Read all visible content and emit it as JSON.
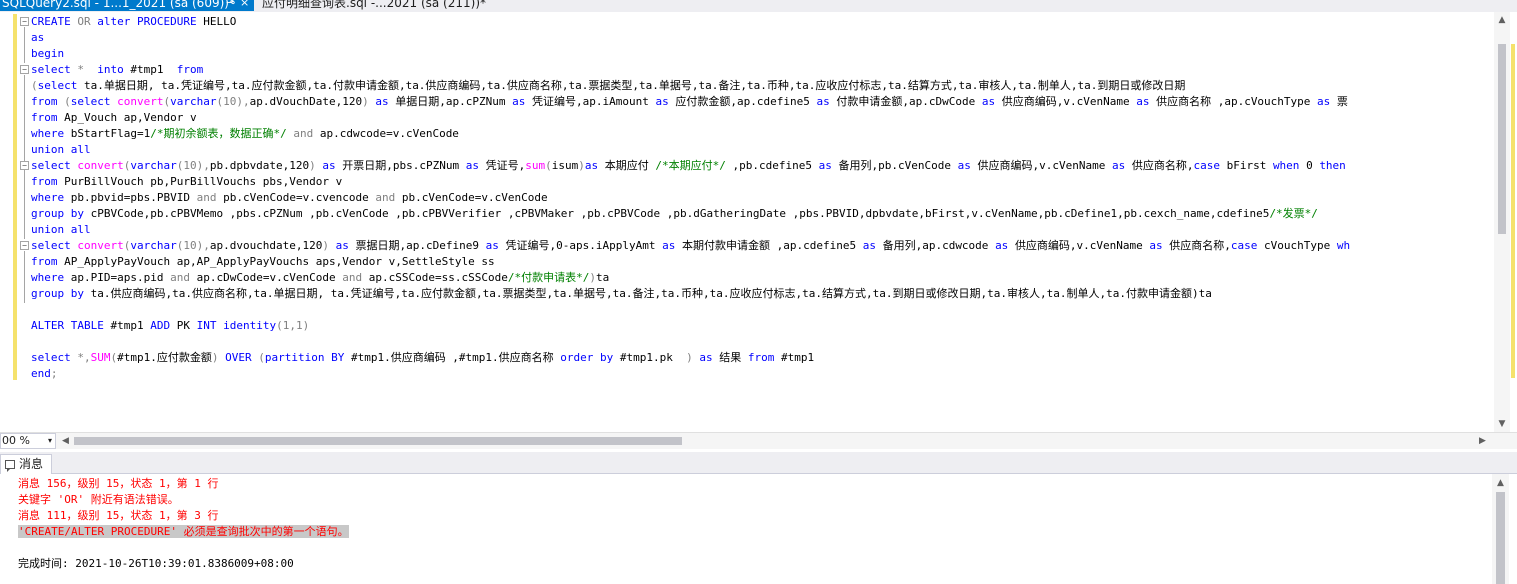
{
  "tabs": [
    {
      "title": "SQLQuery2.sql - 1...1_2021 (sa (609))*",
      "pin": "⊸",
      "close": "×",
      "active": true
    },
    {
      "title": "应付明细查询表.sql -...2021 (sa (211))*",
      "active": false
    }
  ],
  "code_lines": [
    [
      {
        "t": "CREATE ",
        "c": "kw"
      },
      {
        "t": "OR ",
        "c": "gr"
      },
      {
        "t": "alter PROCEDURE ",
        "c": "kw"
      },
      {
        "t": "HELLO",
        "c": ""
      }
    ],
    [
      {
        "t": "as",
        "c": "kw"
      }
    ],
    [
      {
        "t": "begin",
        "c": "kw"
      }
    ],
    [
      {
        "t": "select ",
        "c": "kw"
      },
      {
        "t": "* ",
        "c": "gr"
      },
      {
        "t": " into ",
        "c": "kw"
      },
      {
        "t": "#tmp1  ",
        "c": ""
      },
      {
        "t": "from",
        "c": "kw"
      }
    ],
    [
      {
        "t": "(",
        "c": "gr"
      },
      {
        "t": "select ",
        "c": "kw"
      },
      {
        "t": "ta.单据日期, ta.凭证编号,ta.应付款金额,ta.付款申请金额,ta.供应商编码,ta.供应商名称,ta.票据类型,ta.单据号,ta.备注,ta.币种,ta.应收应付标志,ta.结算方式,ta.审核人,ta.制单人,ta.到期日或修改日期",
        "c": ""
      }
    ],
    [
      {
        "t": "from ",
        "c": "kw"
      },
      {
        "t": "(",
        "c": "gr"
      },
      {
        "t": "select ",
        "c": "kw"
      },
      {
        "t": "convert",
        "c": "fn"
      },
      {
        "t": "(",
        "c": "gr"
      },
      {
        "t": "varchar",
        "c": "kw"
      },
      {
        "t": "(10),",
        "c": "gr"
      },
      {
        "t": "ap.dVouchDate,120",
        "c": ""
      },
      {
        "t": ") ",
        "c": "gr"
      },
      {
        "t": "as ",
        "c": "kw"
      },
      {
        "t": "单据日期,ap.cPZNum ",
        "c": ""
      },
      {
        "t": "as ",
        "c": "kw"
      },
      {
        "t": "凭证编号,ap.iAmount ",
        "c": ""
      },
      {
        "t": "as ",
        "c": "kw"
      },
      {
        "t": "应付款金额,ap.cdefine5 ",
        "c": ""
      },
      {
        "t": "as ",
        "c": "kw"
      },
      {
        "t": "付款申请金额,ap.cDwCode ",
        "c": ""
      },
      {
        "t": "as ",
        "c": "kw"
      },
      {
        "t": "供应商编码,v.cVenName ",
        "c": ""
      },
      {
        "t": "as ",
        "c": "kw"
      },
      {
        "t": "供应商名称 ,ap.cVouchType ",
        "c": ""
      },
      {
        "t": "as ",
        "c": "kw"
      },
      {
        "t": "票",
        "c": ""
      }
    ],
    [
      {
        "t": "from ",
        "c": "kw"
      },
      {
        "t": "Ap_Vouch ap,Vendor v",
        "c": ""
      }
    ],
    [
      {
        "t": "where ",
        "c": "kw"
      },
      {
        "t": "bStartFlag=1",
        "c": ""
      },
      {
        "t": "/*期初余额表，数据正确*/ ",
        "c": "cm"
      },
      {
        "t": "and ",
        "c": "gr"
      },
      {
        "t": "ap.cdwcode=v.cVenCode",
        "c": ""
      }
    ],
    [
      {
        "t": "union all",
        "c": "kw"
      }
    ],
    [
      {
        "t": "select ",
        "c": "kw"
      },
      {
        "t": "convert",
        "c": "fn"
      },
      {
        "t": "(",
        "c": "gr"
      },
      {
        "t": "varchar",
        "c": "kw"
      },
      {
        "t": "(10),",
        "c": "gr"
      },
      {
        "t": "pb.dpbvdate,120",
        "c": ""
      },
      {
        "t": ") ",
        "c": "gr"
      },
      {
        "t": "as ",
        "c": "kw"
      },
      {
        "t": "开票日期,pbs.cPZNum ",
        "c": ""
      },
      {
        "t": "as ",
        "c": "kw"
      },
      {
        "t": "凭证号,",
        "c": ""
      },
      {
        "t": "sum",
        "c": "fn"
      },
      {
        "t": "(",
        "c": "gr"
      },
      {
        "t": "isum",
        "c": ""
      },
      {
        "t": ")",
        "c": "gr"
      },
      {
        "t": "as ",
        "c": "kw"
      },
      {
        "t": "本期应付 ",
        "c": ""
      },
      {
        "t": "/*本期应付*/ ",
        "c": "cm"
      },
      {
        "t": ",pb.cdefine5 ",
        "c": ""
      },
      {
        "t": "as ",
        "c": "kw"
      },
      {
        "t": "备用列,pb.cVenCode ",
        "c": ""
      },
      {
        "t": "as ",
        "c": "kw"
      },
      {
        "t": "供应商编码,v.cVenName ",
        "c": ""
      },
      {
        "t": "as ",
        "c": "kw"
      },
      {
        "t": "供应商名称,",
        "c": ""
      },
      {
        "t": "case ",
        "c": "kw"
      },
      {
        "t": "bFirst ",
        "c": ""
      },
      {
        "t": "when ",
        "c": "kw"
      },
      {
        "t": "0 ",
        "c": ""
      },
      {
        "t": "then",
        "c": "kw"
      }
    ],
    [
      {
        "t": "from ",
        "c": "kw"
      },
      {
        "t": "PurBillVouch pb,PurBillVouchs pbs,Vendor v",
        "c": ""
      }
    ],
    [
      {
        "t": "where ",
        "c": "kw"
      },
      {
        "t": "pb.pbvid=pbs.PBVID ",
        "c": ""
      },
      {
        "t": "and ",
        "c": "gr"
      },
      {
        "t": "pb.cVenCode=v.cvencode ",
        "c": ""
      },
      {
        "t": "and ",
        "c": "gr"
      },
      {
        "t": "pb.cVenCode=v.cVenCode",
        "c": ""
      }
    ],
    [
      {
        "t": "group by ",
        "c": "kw"
      },
      {
        "t": "cPBVCode,pb.cPBVMemo ,pbs.cPZNum ,pb.cVenCode ,pb.cPBVVerifier ,cPBVMaker ,pb.cPBVCode ,pb.dGatheringDate ,pbs.PBVID,dpbvdate,bFirst,v.cVenName,pb.cDefine1,pb.cexch_name,cdefine5",
        "c": ""
      },
      {
        "t": "/*发票*/",
        "c": "cm"
      }
    ],
    [
      {
        "t": "union all",
        "c": "kw"
      }
    ],
    [
      {
        "t": "select ",
        "c": "kw"
      },
      {
        "t": "convert",
        "c": "fn"
      },
      {
        "t": "(",
        "c": "gr"
      },
      {
        "t": "varchar",
        "c": "kw"
      },
      {
        "t": "(10),",
        "c": "gr"
      },
      {
        "t": "ap.dvouchdate,120",
        "c": ""
      },
      {
        "t": ") ",
        "c": "gr"
      },
      {
        "t": "as ",
        "c": "kw"
      },
      {
        "t": "票据日期,ap.cDefine9 ",
        "c": ""
      },
      {
        "t": "as ",
        "c": "kw"
      },
      {
        "t": "凭证编号,0-aps.iApplyAmt ",
        "c": ""
      },
      {
        "t": "as ",
        "c": "kw"
      },
      {
        "t": "本期付款申请金额 ,ap.cdefine5 ",
        "c": ""
      },
      {
        "t": "as ",
        "c": "kw"
      },
      {
        "t": "备用列,ap.cdwcode ",
        "c": ""
      },
      {
        "t": "as ",
        "c": "kw"
      },
      {
        "t": "供应商编码,v.cVenName ",
        "c": ""
      },
      {
        "t": "as ",
        "c": "kw"
      },
      {
        "t": "供应商名称,",
        "c": ""
      },
      {
        "t": "case ",
        "c": "kw"
      },
      {
        "t": "cVouchType ",
        "c": ""
      },
      {
        "t": "wh",
        "c": "kw"
      }
    ],
    [
      {
        "t": "from ",
        "c": "kw"
      },
      {
        "t": "AP_ApplyPayVouch ap,AP_ApplyPayVouchs aps,Vendor v,SettleStyle ss",
        "c": ""
      }
    ],
    [
      {
        "t": "where ",
        "c": "kw"
      },
      {
        "t": "ap.PID=aps.pid ",
        "c": ""
      },
      {
        "t": "and ",
        "c": "gr"
      },
      {
        "t": "ap.cDwCode=v.cVenCode ",
        "c": ""
      },
      {
        "t": "and ",
        "c": "gr"
      },
      {
        "t": "ap.cSSCode=ss.cSSCode",
        "c": ""
      },
      {
        "t": "/*付款申请表*/",
        "c": "cm"
      },
      {
        "t": ")",
        "c": "gr"
      },
      {
        "t": "ta",
        "c": ""
      }
    ],
    [
      {
        "t": "group by ",
        "c": "kw"
      },
      {
        "t": "ta.供应商编码,ta.供应商名称,ta.单据日期, ta.凭证编号,ta.应付款金额,ta.票据类型,ta.单据号,ta.备注,ta.币种,ta.应收应付标志,ta.结算方式,ta.到期日或修改日期,ta.审核人,ta.制单人,ta.付款申请金额)ta",
        "c": ""
      }
    ],
    [],
    [
      {
        "t": "ALTER TABLE ",
        "c": "kw"
      },
      {
        "t": "#tmp1 ",
        "c": ""
      },
      {
        "t": "ADD ",
        "c": "kw"
      },
      {
        "t": "PK ",
        "c": ""
      },
      {
        "t": "INT identity",
        "c": "kw"
      },
      {
        "t": "(1,1)",
        "c": "gr"
      }
    ],
    [],
    [
      {
        "t": "select ",
        "c": "kw"
      },
      {
        "t": "*,",
        "c": "gr"
      },
      {
        "t": "SUM",
        "c": "fn"
      },
      {
        "t": "(",
        "c": "gr"
      },
      {
        "t": "#tmp1.应付款金额",
        "c": ""
      },
      {
        "t": ") ",
        "c": "gr"
      },
      {
        "t": "OVER ",
        "c": "kw"
      },
      {
        "t": "(",
        "c": "gr"
      },
      {
        "t": "partition BY ",
        "c": "kw"
      },
      {
        "t": "#tmp1.供应商编码 ,#tmp1.供应商名称 ",
        "c": ""
      },
      {
        "t": "order by ",
        "c": "kw"
      },
      {
        "t": "#tmp1.pk  ",
        "c": ""
      },
      {
        "t": ") ",
        "c": "gr"
      },
      {
        "t": "as ",
        "c": "kw"
      },
      {
        "t": "结果 ",
        "c": ""
      },
      {
        "t": "from ",
        "c": "kw"
      },
      {
        "t": "#tmp1",
        "c": ""
      }
    ],
    [
      {
        "t": "end",
        "c": "kw"
      },
      {
        "t": ";",
        "c": "gr"
      }
    ]
  ],
  "zoom": {
    "value": "00 %",
    "caret": "▾"
  },
  "results_tab": {
    "label": "消息"
  },
  "messages": [
    {
      "text": "消息 156，级别 15，状态 1，第 1 行",
      "kind": "err"
    },
    {
      "text": "关键字 'OR' 附近有语法错误。",
      "kind": "err"
    },
    {
      "text": "消息 111，级别 15，状态 1，第 3 行",
      "kind": "err"
    },
    {
      "text": "'CREATE/ALTER PROCEDURE' 必须是查询批次中的第一个语句。",
      "kind": "err",
      "selected": true
    },
    {
      "text": "",
      "kind": "ok"
    },
    {
      "text": "完成时间: 2021-10-26T10:39:01.8386009+08:00",
      "kind": "ok"
    }
  ],
  "colors": {
    "keyword": "#0000ff",
    "function": "#ff00ff",
    "operator": "#808080",
    "comment": "#008000",
    "error": "#ff0000",
    "accent": "#007acc",
    "change_marker": "#f5e26c"
  }
}
